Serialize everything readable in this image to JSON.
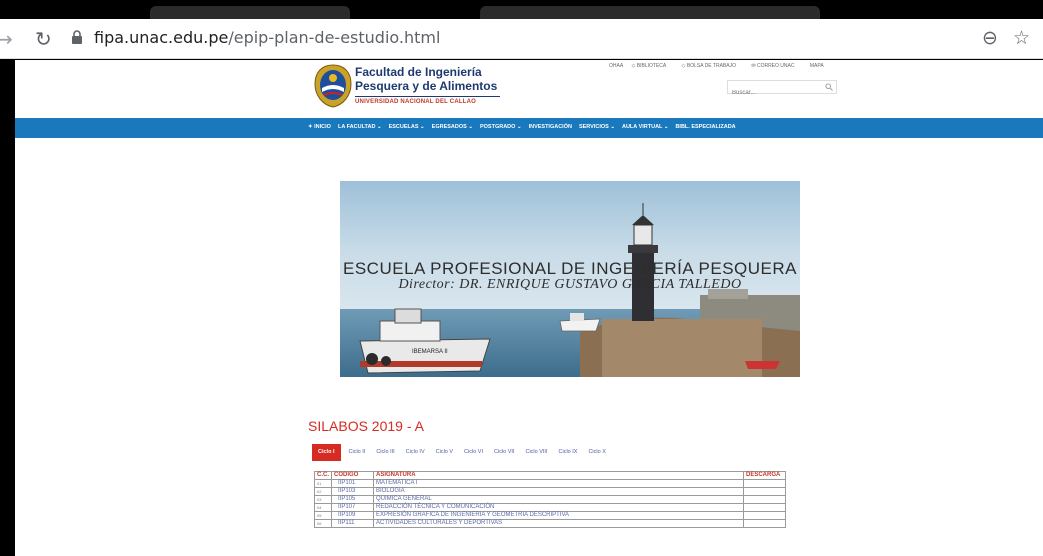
{
  "browser": {
    "url_host": "fipa.unac.edu.pe",
    "url_path": "/epip-plan-de-estudio.html"
  },
  "header": {
    "faculty_line1": "Facultad de Ingeniería",
    "faculty_line2": "Pesquera y de Alimentos",
    "university": "UNIVERSIDAD NACIONAL DEL CALLAO",
    "top_links": [
      "OHAA",
      "BIBLIOTECA",
      "BOLSA DE TRABAJO",
      "CORREO UNAC",
      "MAPA"
    ],
    "search_placeholder": "Buscar..."
  },
  "nav": {
    "items": [
      "INICIO",
      "LA FACULTAD",
      "ESCUELAS",
      "EGRESADOS",
      "POSTGRADO",
      "INVESTIGACIÓN",
      "SERVICIOS",
      "AULA VIRTUAL",
      "BIBL. ESPECIALIZADA"
    ]
  },
  "banner": {
    "title": "ESCUELA PROFESIONAL DE INGENIERÍA PESQUERA",
    "director": "Director: DR. ENRIQUE GUSTAVO GARCIA TALLEDO",
    "boat_name": "IBEMARSA II"
  },
  "silabos": {
    "title": "SILABOS 2019 - A",
    "cycles": [
      "Ciclo I",
      "Ciclo II",
      "Ciclo III",
      "Ciclo IV",
      "Ciclo V",
      "Ciclo VI",
      "Ciclo VII",
      "Ciclo VIII",
      "Ciclo IX",
      "Ciclo X"
    ],
    "active_cycle_index": 0,
    "headers": [
      "C.C.",
      "CODIGO",
      "ASIGNATURA",
      "DESCARGA"
    ],
    "rows": [
      [
        "01",
        "IIP101",
        "MATEMATICA I",
        ""
      ],
      [
        "02",
        "IIP103",
        "BIOLOGIA",
        ""
      ],
      [
        "03",
        "IIP105",
        "QUIMICA GENERAL",
        ""
      ],
      [
        "04",
        "IIP107",
        "REDACCIÓN TÉCNICA Y COMUNICACIÓN",
        ""
      ],
      [
        "05",
        "IIP109",
        "EXPRESIÓN GRAFICA DE INGENIERIA Y GEOMETRIA DESCRIPTIVA",
        ""
      ],
      [
        "06",
        "IIP111",
        "ACTIVIDADES CULTURALES Y DEPORTIVAS",
        ""
      ]
    ]
  },
  "colors": {
    "nav_blue": "#1a78bd",
    "accent_red": "#d62b22",
    "brand_navy": "#1e3a6e",
    "link_blue": "#4a5ba8"
  }
}
